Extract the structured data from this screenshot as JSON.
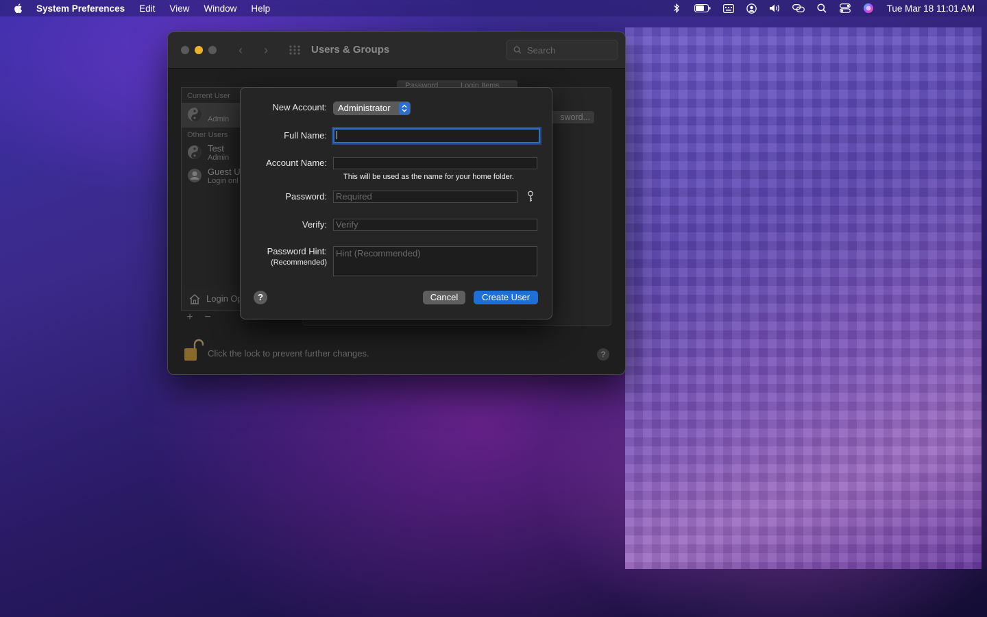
{
  "menubar": {
    "app_name": "System Preferences",
    "items": [
      "Edit",
      "View",
      "Window",
      "Help"
    ],
    "clock": "Tue Mar 18  11:01 AM",
    "status_icons": [
      "bluetooth-icon",
      "battery-icon",
      "keyboard-input-icon",
      "user-account-icon",
      "volume-icon",
      "screen-mirroring-icon",
      "spotlight-search-icon",
      "control-center-icon",
      "siri-icon"
    ]
  },
  "window": {
    "title": "Users & Groups",
    "search_placeholder": "Search",
    "tabs": [
      "Password",
      "Login Items"
    ],
    "change_password_label": "sword...",
    "lock_text": "Click the lock to prevent further changes.",
    "help_label": "?"
  },
  "users_list": {
    "current_user_label": "Current User",
    "other_users_label": "Other Users",
    "current": {
      "name": "",
      "role": "Admin"
    },
    "others": [
      {
        "name": "Test",
        "role": "Admin"
      },
      {
        "name": "Guest U",
        "role": "Login onl"
      }
    ],
    "login_options_label": "Login Op",
    "add_label": "+",
    "remove_label": "−"
  },
  "sheet": {
    "new_account_label": "New Account:",
    "new_account_value": "Administrator",
    "full_name_label": "Full Name:",
    "full_name_value": "",
    "account_name_label": "Account Name:",
    "account_name_value": "",
    "account_name_hint": "This will be used as the name for your home folder.",
    "password_label": "Password:",
    "password_placeholder": "Required",
    "verify_label": "Verify:",
    "verify_placeholder": "Verify",
    "hint_label": "Password Hint:",
    "hint_sublabel": "(Recommended)",
    "hint_placeholder": "Hint (Recommended)",
    "help_label": "?",
    "cancel_label": "Cancel",
    "create_label": "Create User"
  },
  "colors": {
    "accent": "#1f6fd8",
    "sheet_bg": "#252525",
    "window_bg": "#1e1e1e"
  }
}
